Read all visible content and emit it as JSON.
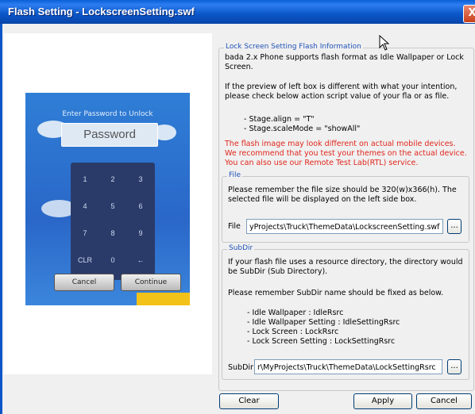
{
  "window": {
    "title": "Flash Setting - LockscreenSetting.swf",
    "close_glyph": "X"
  },
  "preview": {
    "password_prompt": "Enter Password to Unlock",
    "password_placeholder": "Password",
    "keys": [
      "1",
      "2",
      "3",
      "4",
      "5",
      "6",
      "7",
      "8",
      "9",
      "CLR",
      "0",
      "←"
    ],
    "cancel_label": "Cancel",
    "continue_label": "Continue"
  },
  "info": {
    "legend": "Lock Screen Setting Flash Information",
    "line1": "bada 2.x Phone supports flash format as Idle Wallpaper or Lock Screen.",
    "line2": "If the preview of left box is different with what your intention, please check below action script value of your fla or as file.",
    "align": "- Stage.align = \"T\"",
    "scale": "- Stage.scaleMode = \"showAll\"",
    "warn1": "The flash image may look different on actual mobile devices.",
    "warn2": "We recommend that you test your themes on the actual device.",
    "warn3": "You can also use our Remote Test Lab(RTL) service."
  },
  "file": {
    "legend": "File",
    "desc": "Please remember the file size should be 320(w)x366(h). The selected file will be displayed on the left side box.",
    "label": "File",
    "value": "yProjects\\Truck\\ThemeData\\LockscreenSetting.swf",
    "browse_label": "..."
  },
  "subdir": {
    "legend": "SubDir",
    "desc": "If your flash file uses a resource directory, the directory would be SubDir (Sub Directory).",
    "remember": "Please remember SubDir name should be fixed as below.",
    "items": [
      "- Idle Wallpaper : IdleRsrc",
      "- Idle Wallpaper Setting : IdleSettingRsrc",
      "- Lock Screen : LockRsrc",
      "- Lock Screen Setting : LockSettingRsrc"
    ],
    "label": "SubDir",
    "value": "r\\MyProjects\\Truck\\ThemeData\\LockSettingRsrc",
    "browse_label": "..."
  },
  "footer": {
    "clear_label": "Clear",
    "apply_label": "Apply",
    "cancel_label": "Cancel"
  },
  "colors": {
    "titlebar": "#0a56c8",
    "legend_text": "#2152b7",
    "warning_text": "#e0261c"
  }
}
